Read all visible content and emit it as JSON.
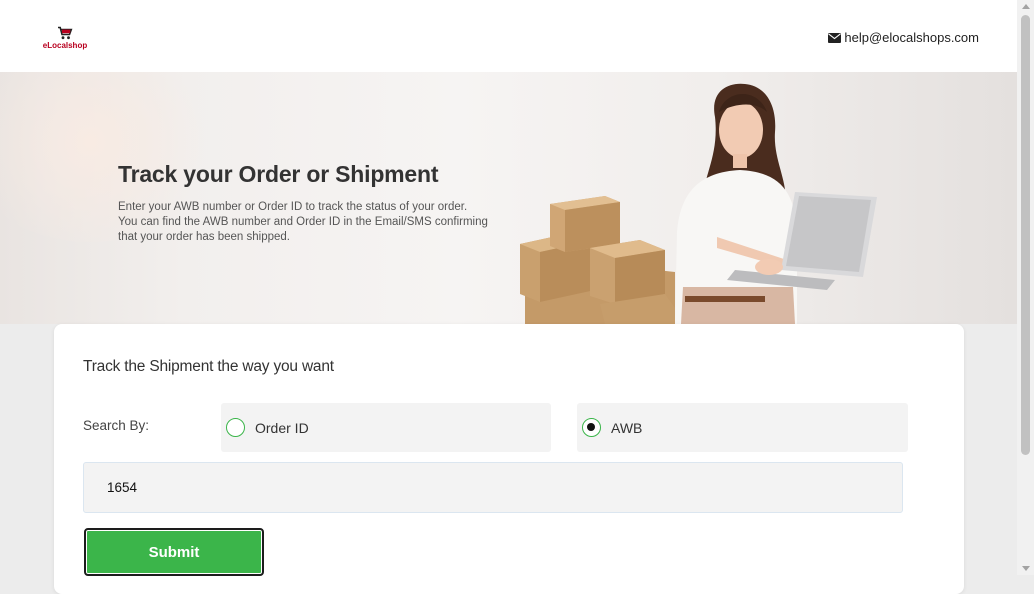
{
  "header": {
    "logo_text": "eLocalshop",
    "contact_email": "help@elocalshops.com"
  },
  "hero": {
    "title": "Track your Order or Shipment",
    "description_lines": [
      "Enter your AWB number or Order ID to track the status of your order.",
      "You can find the AWB number and Order ID in the Email/SMS confirming",
      "that your order has been shipped."
    ]
  },
  "form": {
    "title": "Track the Shipment the way you want",
    "search_by_label": "Search By:",
    "options": [
      {
        "label": "Order ID",
        "selected": false
      },
      {
        "label": "AWB",
        "selected": true
      }
    ],
    "input_value": "1654",
    "submit_label": "Submit"
  },
  "colors": {
    "accent_green": "#3bb54a",
    "logo_red": "#b8001f"
  },
  "icons": {
    "logo": "cart-icon",
    "email": "envelope-icon"
  }
}
